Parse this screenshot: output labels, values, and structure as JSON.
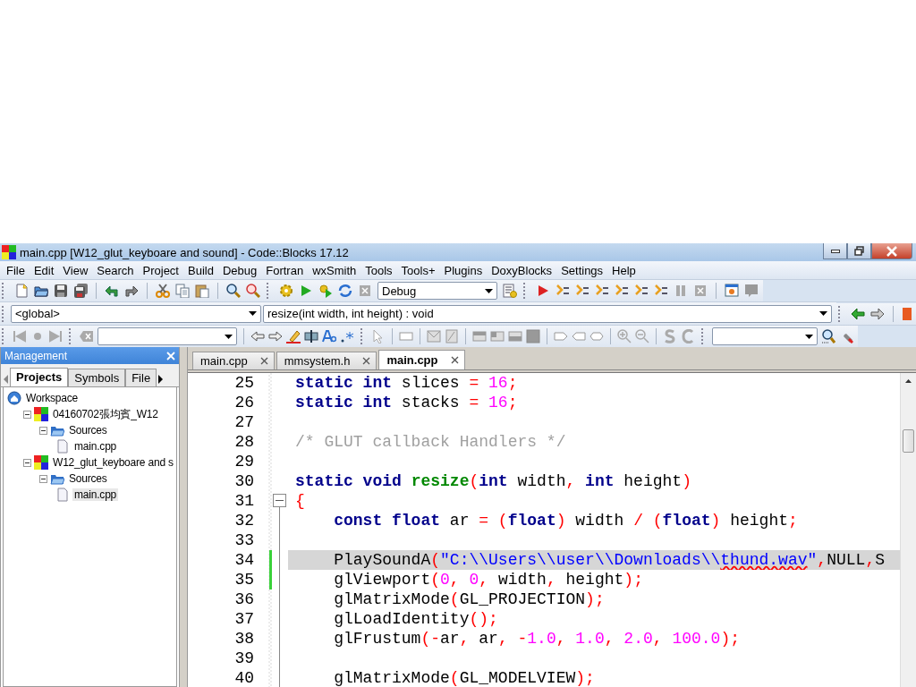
{
  "window": {
    "title": "main.cpp [W12_glut_keyboare and sound] - Code::Blocks 17.12"
  },
  "menu": [
    "File",
    "Edit",
    "View",
    "Search",
    "Project",
    "Build",
    "Debug",
    "Fortran",
    "wxSmith",
    "Tools",
    "Tools+",
    "Plugins",
    "DoxyBlocks",
    "Settings",
    "Help"
  ],
  "toolbars": {
    "build_target": "Debug",
    "scope": "<global>",
    "function": "resize(int width, int height) : void"
  },
  "management": {
    "title": "Management",
    "tabs": [
      {
        "label": "Projects",
        "selected": true
      },
      {
        "label": "Symbols",
        "selected": false
      },
      {
        "label": "File",
        "selected": false
      }
    ],
    "tree": [
      {
        "label": "Workspace",
        "kind": "workspace",
        "selected": false,
        "children": [
          {
            "label": "04160702張均賓_W12",
            "kind": "project",
            "expanded": true,
            "selected": false,
            "children": [
              {
                "label": "Sources",
                "kind": "folder",
                "expanded": true,
                "selected": false,
                "children": [
                  {
                    "label": "main.cpp",
                    "kind": "file",
                    "selected": false
                  }
                ]
              }
            ]
          },
          {
            "label": "W12_glut_keyboare and s",
            "kind": "project",
            "expanded": true,
            "selected": false,
            "children": [
              {
                "label": "Sources",
                "kind": "folder",
                "expanded": true,
                "selected": false,
                "children": [
                  {
                    "label": "main.cpp",
                    "kind": "file",
                    "selected": true
                  }
                ]
              }
            ]
          }
        ]
      }
    ]
  },
  "editor": {
    "tabs": [
      {
        "label": "main.cpp",
        "selected": false
      },
      {
        "label": "mmsystem.h",
        "selected": false
      },
      {
        "label": "main.cpp",
        "selected": true
      }
    ],
    "lines": [
      {
        "number": "25",
        "changed": false,
        "highlighted": false,
        "fold_start": false,
        "tokens": [
          {
            "kind": "kw",
            "text": "static"
          },
          {
            "kind": "kw",
            "text": " int"
          },
          {
            "kind": "plain",
            "text": " slices "
          },
          {
            "kind": "op",
            "text": "="
          },
          {
            "kind": "num",
            "text": " 16"
          },
          {
            "kind": "op",
            "text": ";"
          }
        ]
      },
      {
        "number": "26",
        "changed": false,
        "highlighted": false,
        "fold_start": false,
        "tokens": [
          {
            "kind": "kw",
            "text": "static"
          },
          {
            "kind": "kw",
            "text": " int"
          },
          {
            "kind": "plain",
            "text": " stacks "
          },
          {
            "kind": "op",
            "text": "="
          },
          {
            "kind": "num",
            "text": " 16"
          },
          {
            "kind": "op",
            "text": ";"
          }
        ]
      },
      {
        "number": "27",
        "changed": false,
        "highlighted": false,
        "fold_start": false
      },
      {
        "number": "28",
        "changed": false,
        "highlighted": false,
        "fold_start": false,
        "tokens": [
          {
            "kind": "comment",
            "text": "/* GLUT callback Handlers */"
          }
        ]
      },
      {
        "number": "29",
        "changed": false,
        "highlighted": false,
        "fold_start": false
      },
      {
        "number": "30",
        "changed": false,
        "highlighted": false,
        "fold_start": false,
        "tokens": [
          {
            "kind": "kw",
            "text": "static"
          },
          {
            "kind": "kw",
            "text": " void"
          },
          {
            "kind": "fn",
            "text": " resize"
          },
          {
            "kind": "op",
            "text": "("
          },
          {
            "kind": "kw",
            "text": "int"
          },
          {
            "kind": "plain",
            "text": " width"
          },
          {
            "kind": "op",
            "text": ","
          },
          {
            "kind": "kw",
            "text": " int"
          },
          {
            "kind": "plain",
            "text": " height"
          },
          {
            "kind": "op",
            "text": ")"
          }
        ]
      },
      {
        "number": "31",
        "changed": false,
        "highlighted": false,
        "fold_start": true,
        "tokens": [
          {
            "kind": "op",
            "text": "{"
          }
        ]
      },
      {
        "number": "32",
        "changed": false,
        "highlighted": false,
        "fold_start": false,
        "tokens": [
          {
            "kind": "kw",
            "text": "    const"
          },
          {
            "kind": "kw",
            "text": " float"
          },
          {
            "kind": "plain",
            "text": " ar "
          },
          {
            "kind": "op",
            "text": "="
          },
          {
            "kind": "op",
            "text": " ("
          },
          {
            "kind": "kw",
            "text": "float"
          },
          {
            "kind": "op",
            "text": ")"
          },
          {
            "kind": "plain",
            "text": " width "
          },
          {
            "kind": "op",
            "text": "/"
          },
          {
            "kind": "op",
            "text": " ("
          },
          {
            "kind": "kw",
            "text": "float"
          },
          {
            "kind": "op",
            "text": ")"
          },
          {
            "kind": "plain",
            "text": " height"
          },
          {
            "kind": "op",
            "text": ";"
          }
        ]
      },
      {
        "number": "33",
        "changed": false,
        "highlighted": false,
        "fold_start": false
      },
      {
        "number": "34",
        "changed": true,
        "highlighted": true,
        "fold_start": false,
        "tokens": [
          {
            "kind": "plain",
            "text": "    PlaySoundA"
          },
          {
            "kind": "op",
            "text": "("
          },
          {
            "kind": "str",
            "text": "\"C:\\\\Users\\\\user\\\\Downloads\\\\"
          },
          {
            "kind": "typo",
            "text": "thund.wav"
          },
          {
            "kind": "str",
            "text": "\""
          },
          {
            "kind": "op",
            "text": ","
          },
          {
            "kind": "plain",
            "text": "NULL"
          },
          {
            "kind": "op",
            "text": ","
          },
          {
            "kind": "plain",
            "text": "S"
          }
        ]
      },
      {
        "number": "35",
        "changed": true,
        "highlighted": false,
        "fold_start": false,
        "tokens": [
          {
            "kind": "plain",
            "text": "    glViewport"
          },
          {
            "kind": "op",
            "text": "("
          },
          {
            "kind": "num",
            "text": "0"
          },
          {
            "kind": "op",
            "text": ","
          },
          {
            "kind": "num",
            "text": " 0"
          },
          {
            "kind": "op",
            "text": ","
          },
          {
            "kind": "plain",
            "text": " width"
          },
          {
            "kind": "op",
            "text": ","
          },
          {
            "kind": "plain",
            "text": " height"
          },
          {
            "kind": "op",
            "text": ");"
          }
        ]
      },
      {
        "number": "36",
        "changed": false,
        "highlighted": false,
        "fold_start": false,
        "tokens": [
          {
            "kind": "plain",
            "text": "    glMatrixMode"
          },
          {
            "kind": "op",
            "text": "("
          },
          {
            "kind": "plain",
            "text": "GL_PROJECTION"
          },
          {
            "kind": "op",
            "text": ");"
          }
        ]
      },
      {
        "number": "37",
        "changed": false,
        "highlighted": false,
        "fold_start": false,
        "tokens": [
          {
            "kind": "plain",
            "text": "    glLoadIdentity"
          },
          {
            "kind": "op",
            "text": "();"
          }
        ]
      },
      {
        "number": "38",
        "changed": false,
        "highlighted": false,
        "fold_start": false,
        "tokens": [
          {
            "kind": "plain",
            "text": "    glFrustum"
          },
          {
            "kind": "op",
            "text": "(-"
          },
          {
            "kind": "plain",
            "text": "ar"
          },
          {
            "kind": "op",
            "text": ","
          },
          {
            "kind": "plain",
            "text": " ar"
          },
          {
            "kind": "op",
            "text": ","
          },
          {
            "kind": "op",
            "text": " -"
          },
          {
            "kind": "num",
            "text": "1.0"
          },
          {
            "kind": "op",
            "text": ","
          },
          {
            "kind": "num",
            "text": " 1.0"
          },
          {
            "kind": "op",
            "text": ","
          },
          {
            "kind": "num",
            "text": " 2.0"
          },
          {
            "kind": "op",
            "text": ","
          },
          {
            "kind": "num",
            "text": " 100.0"
          },
          {
            "kind": "op",
            "text": ");"
          }
        ]
      },
      {
        "number": "39",
        "changed": false,
        "highlighted": false,
        "fold_start": false
      },
      {
        "number": "40",
        "changed": false,
        "highlighted": false,
        "fold_start": false,
        "tokens": [
          {
            "kind": "plain",
            "text": "    glMatrixMode"
          },
          {
            "kind": "op",
            "text": "("
          },
          {
            "kind": "plain",
            "text": "GL_MODELVIEW"
          },
          {
            "kind": "op",
            "text": ");"
          }
        ]
      }
    ]
  }
}
